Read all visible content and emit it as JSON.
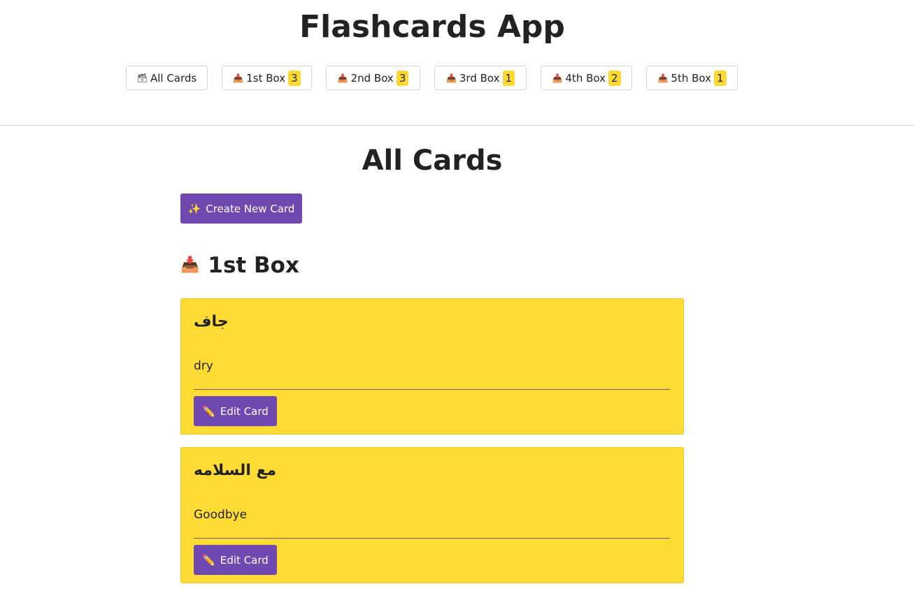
{
  "app": {
    "title": "Flashcards App"
  },
  "nav": {
    "items": [
      {
        "icon": "🗃",
        "label": "All Cards",
        "count": null
      },
      {
        "icon": "📥",
        "label": "1st Box",
        "count": "3"
      },
      {
        "icon": "📥",
        "label": "2nd Box",
        "count": "3"
      },
      {
        "icon": "📥",
        "label": "3rd Box",
        "count": "1"
      },
      {
        "icon": "📥",
        "label": "4th Box",
        "count": "2"
      },
      {
        "icon": "📥",
        "label": "5th Box",
        "count": "1"
      }
    ]
  },
  "page": {
    "title": "All Cards",
    "create_button": {
      "icon": "✨",
      "label": "Create New Card"
    }
  },
  "box": {
    "icon": "📥",
    "title": "1st Box",
    "cards": [
      {
        "front": "جاف",
        "back": "dry",
        "edit_icon": "✏️",
        "edit_label": "Edit Card"
      },
      {
        "front": "مع السلامه",
        "back": "Goodbye",
        "edit_icon": "✏️",
        "edit_label": "Edit Card"
      }
    ]
  },
  "colors": {
    "accent": "#6f48b0",
    "card": "#ffdc33",
    "badge": "#ffd933"
  }
}
